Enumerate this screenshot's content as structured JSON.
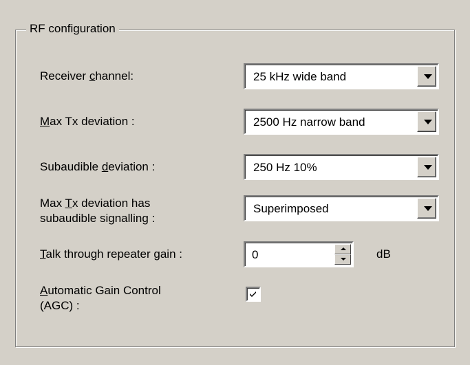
{
  "group": {
    "title": "RF configuration"
  },
  "fields": {
    "receiver_channel": {
      "label_pre": "Receiver ",
      "label_key": "c",
      "label_post": "hannel:",
      "value": "25 kHz wide band"
    },
    "max_tx_deviation": {
      "label_pre": "",
      "label_key": "M",
      "label_post": "ax Tx deviation :",
      "value": "2500 Hz narrow band"
    },
    "subaudible_deviation": {
      "label_pre": "Subaudible ",
      "label_key": "d",
      "label_post": "eviation :",
      "value": "250 Hz 10%"
    },
    "max_tx_subaudible": {
      "label_line1_pre": "Max ",
      "label_line1_key": "T",
      "label_line1_post": "x deviation has",
      "label_line2": "subaudible signalling :",
      "value": "Superimposed"
    },
    "talk_through_gain": {
      "label_pre": "",
      "label_key": "T",
      "label_post": "alk through repeater gain :",
      "value": "0",
      "unit": "dB"
    },
    "agc": {
      "label_line1_pre": "",
      "label_line1_key": "A",
      "label_line1_post": "utomatic Gain Control",
      "label_line2": "(AGC) :",
      "checked": true
    }
  },
  "icons": {
    "combo_arrow": "chevron-down-icon",
    "spin_up": "spin-up-icon",
    "spin_down": "spin-down-icon",
    "check": "check-icon"
  }
}
